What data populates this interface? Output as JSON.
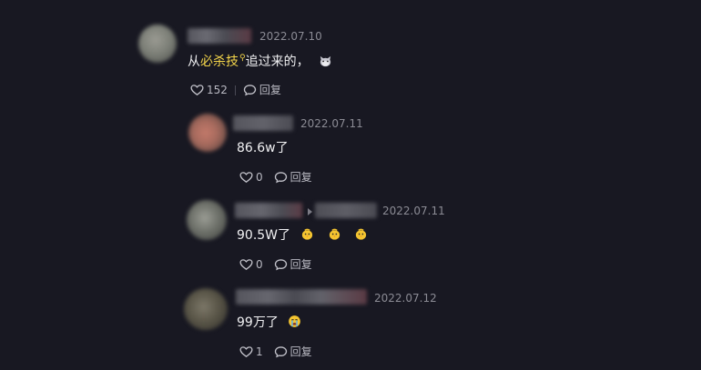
{
  "comments": [
    {
      "date": "2022.07.10",
      "text_before": "从",
      "highlight": "必杀技",
      "text_after": "追过来的，",
      "emoji": "cat-face-icon",
      "likes": "152",
      "reply_label": "回复"
    },
    {
      "date": "2022.07.11",
      "text": "86.6w了",
      "likes": "0",
      "reply_label": "回复"
    },
    {
      "date": "2022.07.11",
      "text": "90.5W了",
      "emojis": [
        "chick-icon",
        "chick-icon",
        "chick-icon"
      ],
      "likes": "0",
      "reply_label": "回复"
    },
    {
      "date": "2022.07.12",
      "text": "99万了",
      "emoji": "crying-face-icon",
      "likes": "1",
      "reply_label": "回复"
    }
  ],
  "colors": {
    "background": "#181822",
    "highlight": "#f5d64a",
    "date": "#8b8b94"
  }
}
